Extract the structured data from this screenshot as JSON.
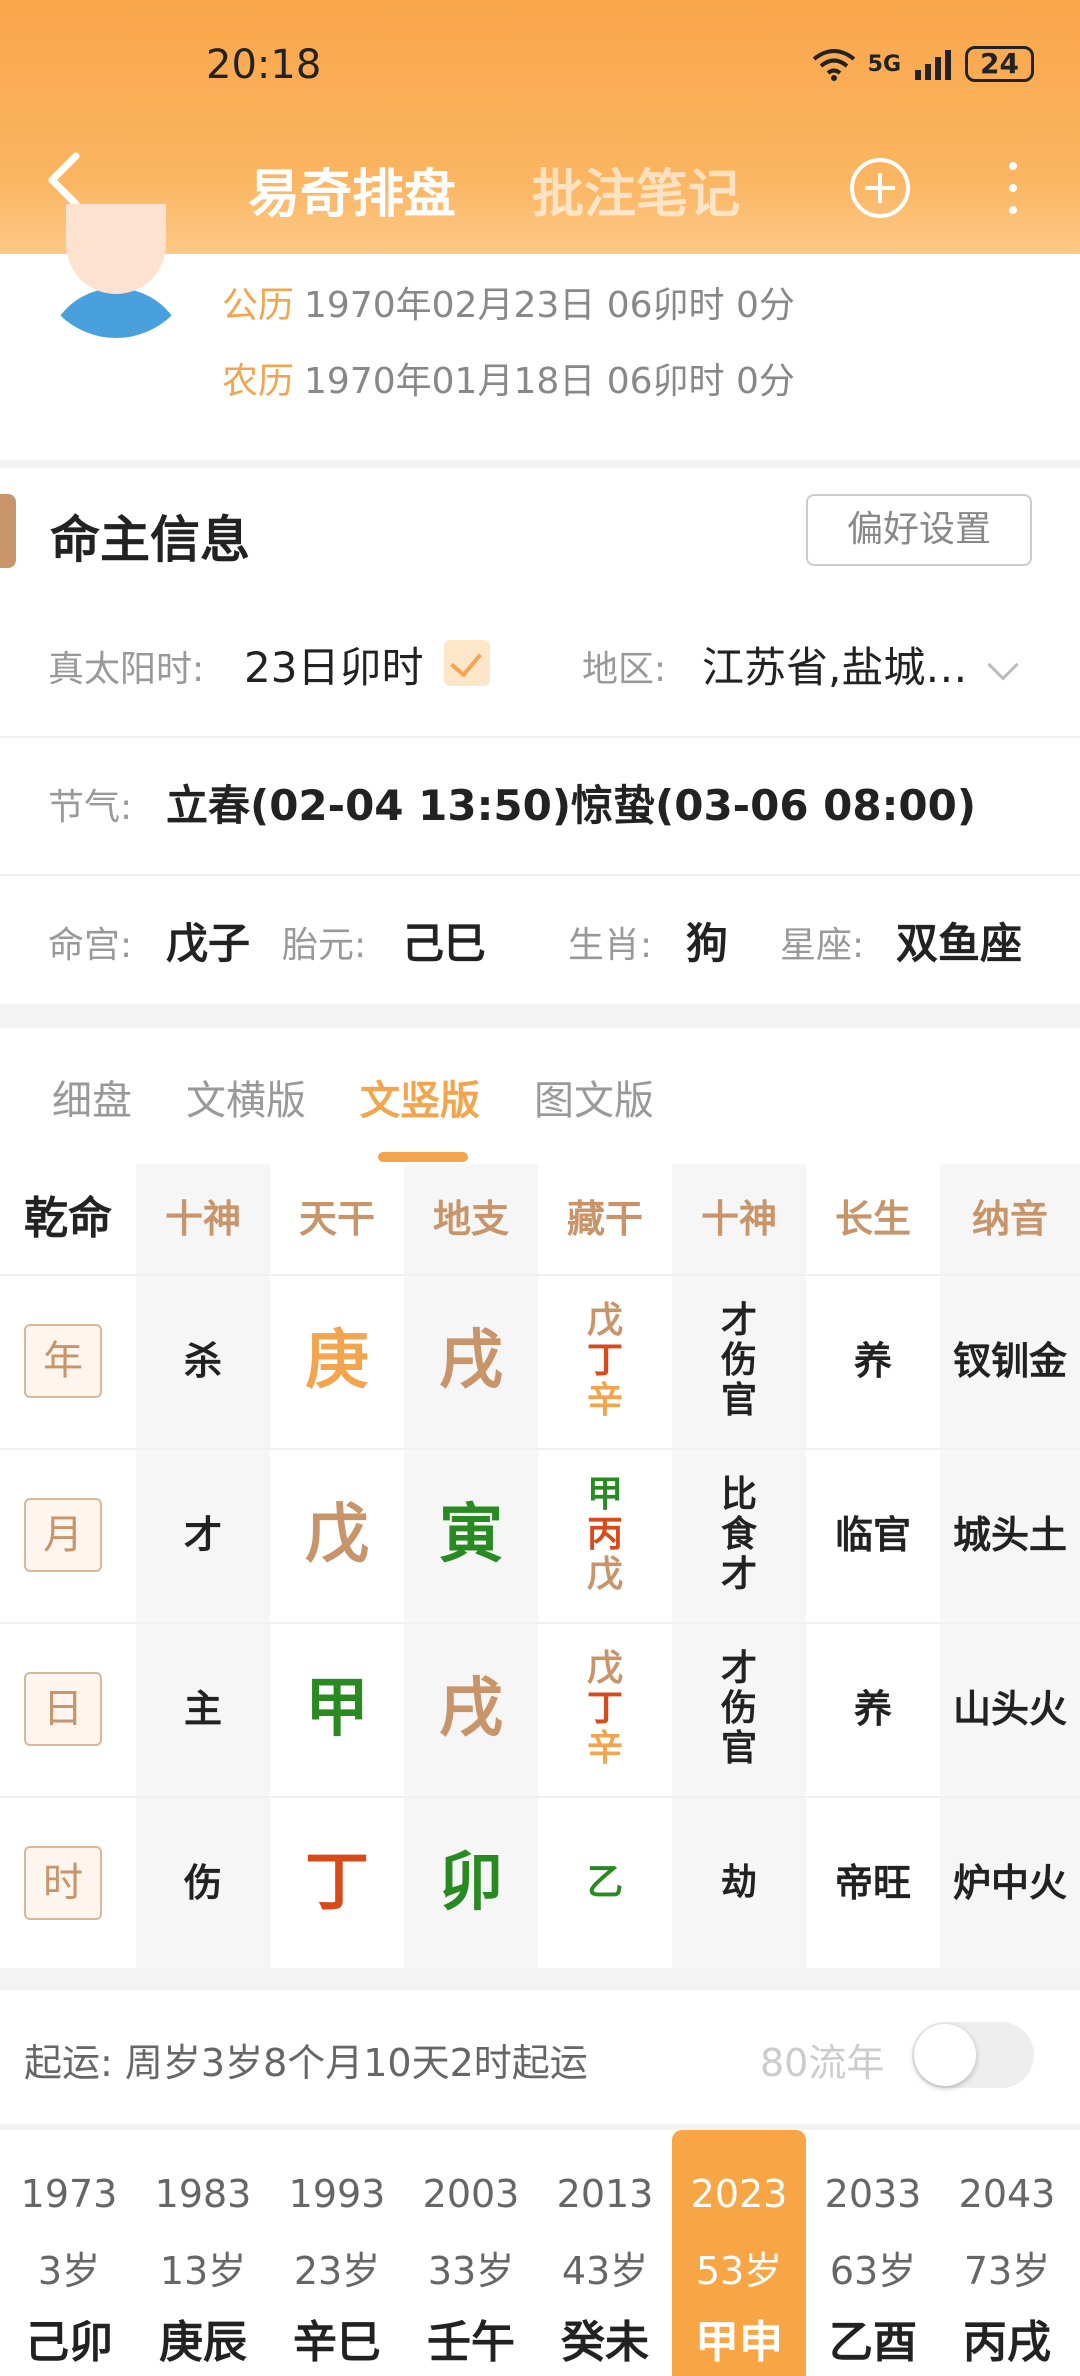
{
  "status_bar": {
    "time": "20:18",
    "network": "5G",
    "battery": "24"
  },
  "nav": {
    "title": "易奇排盘",
    "title2": "批注笔记"
  },
  "profile": {
    "solar_label": "公历",
    "solar_value": "1970年02月23日 06卯时 0分",
    "lunar_label": "农历",
    "lunar_value": "1970年01月18日 06卯时 0分"
  },
  "info": {
    "title": "命主信息",
    "pref_button": "偏好设置",
    "true_solar_label": "真太阳时:",
    "true_solar_value": "23日卯时",
    "region_label": "地区:",
    "region_value": "江苏省,盐城…",
    "jieqi_label": "节气:",
    "jieqi_value": "立春(02-04 13:50)惊蛰(03-06 08:00)",
    "minggong_label": "命宫:",
    "minggong_value": "戊子",
    "taiyuan_label": "胎元:",
    "taiyuan_value": "己巳",
    "shengxiao_label": "生肖:",
    "shengxiao_value": "狗",
    "xingzuo_label": "星座:",
    "xingzuo_value": "双鱼座"
  },
  "tabs": [
    "细盘",
    "文横版",
    "文竖版",
    "图文版"
  ],
  "grid": {
    "headers": [
      "乾命",
      "十神",
      "天干",
      "地支",
      "藏干",
      "十神",
      "长生",
      "纳音"
    ],
    "rows": [
      {
        "label": "年",
        "shishen": "杀",
        "tiangan": "庚",
        "dizhi": "戌",
        "canggan": [
          "戊",
          "丁",
          "辛"
        ],
        "shishen2": [
          "才",
          "伤",
          "官"
        ],
        "changsheng": "养",
        "nayin": "钗钏金"
      },
      {
        "label": "月",
        "shishen": "才",
        "tiangan": "戊",
        "dizhi": "寅",
        "canggan": [
          "甲",
          "丙",
          "戊"
        ],
        "shishen2": [
          "比",
          "食",
          "才"
        ],
        "changsheng": "临官",
        "nayin": "城头土"
      },
      {
        "label": "日",
        "shishen": "主",
        "tiangan": "甲",
        "dizhi": "戌",
        "canggan": [
          "戊",
          "丁",
          "辛"
        ],
        "shishen2": [
          "才",
          "伤",
          "官"
        ],
        "changsheng": "养",
        "nayin": "山头火"
      },
      {
        "label": "时",
        "shishen": "伤",
        "tiangan": "丁",
        "dizhi": "卯",
        "canggan": [
          "乙"
        ],
        "shishen2": [
          "劫"
        ],
        "changsheng": "帝旺",
        "nayin": "炉中火"
      }
    ]
  },
  "qiyun": {
    "label": "起运:",
    "value": "周岁3岁8个月10天2时起运",
    "liunian": "80流年"
  },
  "dayun": [
    {
      "year": "1973",
      "age": "3岁",
      "ganzhi": "己卯"
    },
    {
      "year": "1983",
      "age": "13岁",
      "ganzhi": "庚辰"
    },
    {
      "year": "1993",
      "age": "23岁",
      "ganzhi": "辛巳"
    },
    {
      "year": "2003",
      "age": "33岁",
      "ganzhi": "壬午"
    },
    {
      "year": "2013",
      "age": "43岁",
      "ganzhi": "癸未"
    },
    {
      "year": "2023",
      "age": "53岁",
      "ganzhi": "甲申"
    },
    {
      "year": "2033",
      "age": "63岁",
      "ganzhi": "乙酉"
    },
    {
      "year": "2043",
      "age": "73岁",
      "ganzhi": "丙戌"
    }
  ],
  "colors": {
    "accent": "#f3a54e",
    "brown": "#c8956a",
    "metal": "#f3a54e",
    "earth": "#c8956a",
    "wood": "#2a8a22",
    "fire": "#d94a1a"
  }
}
